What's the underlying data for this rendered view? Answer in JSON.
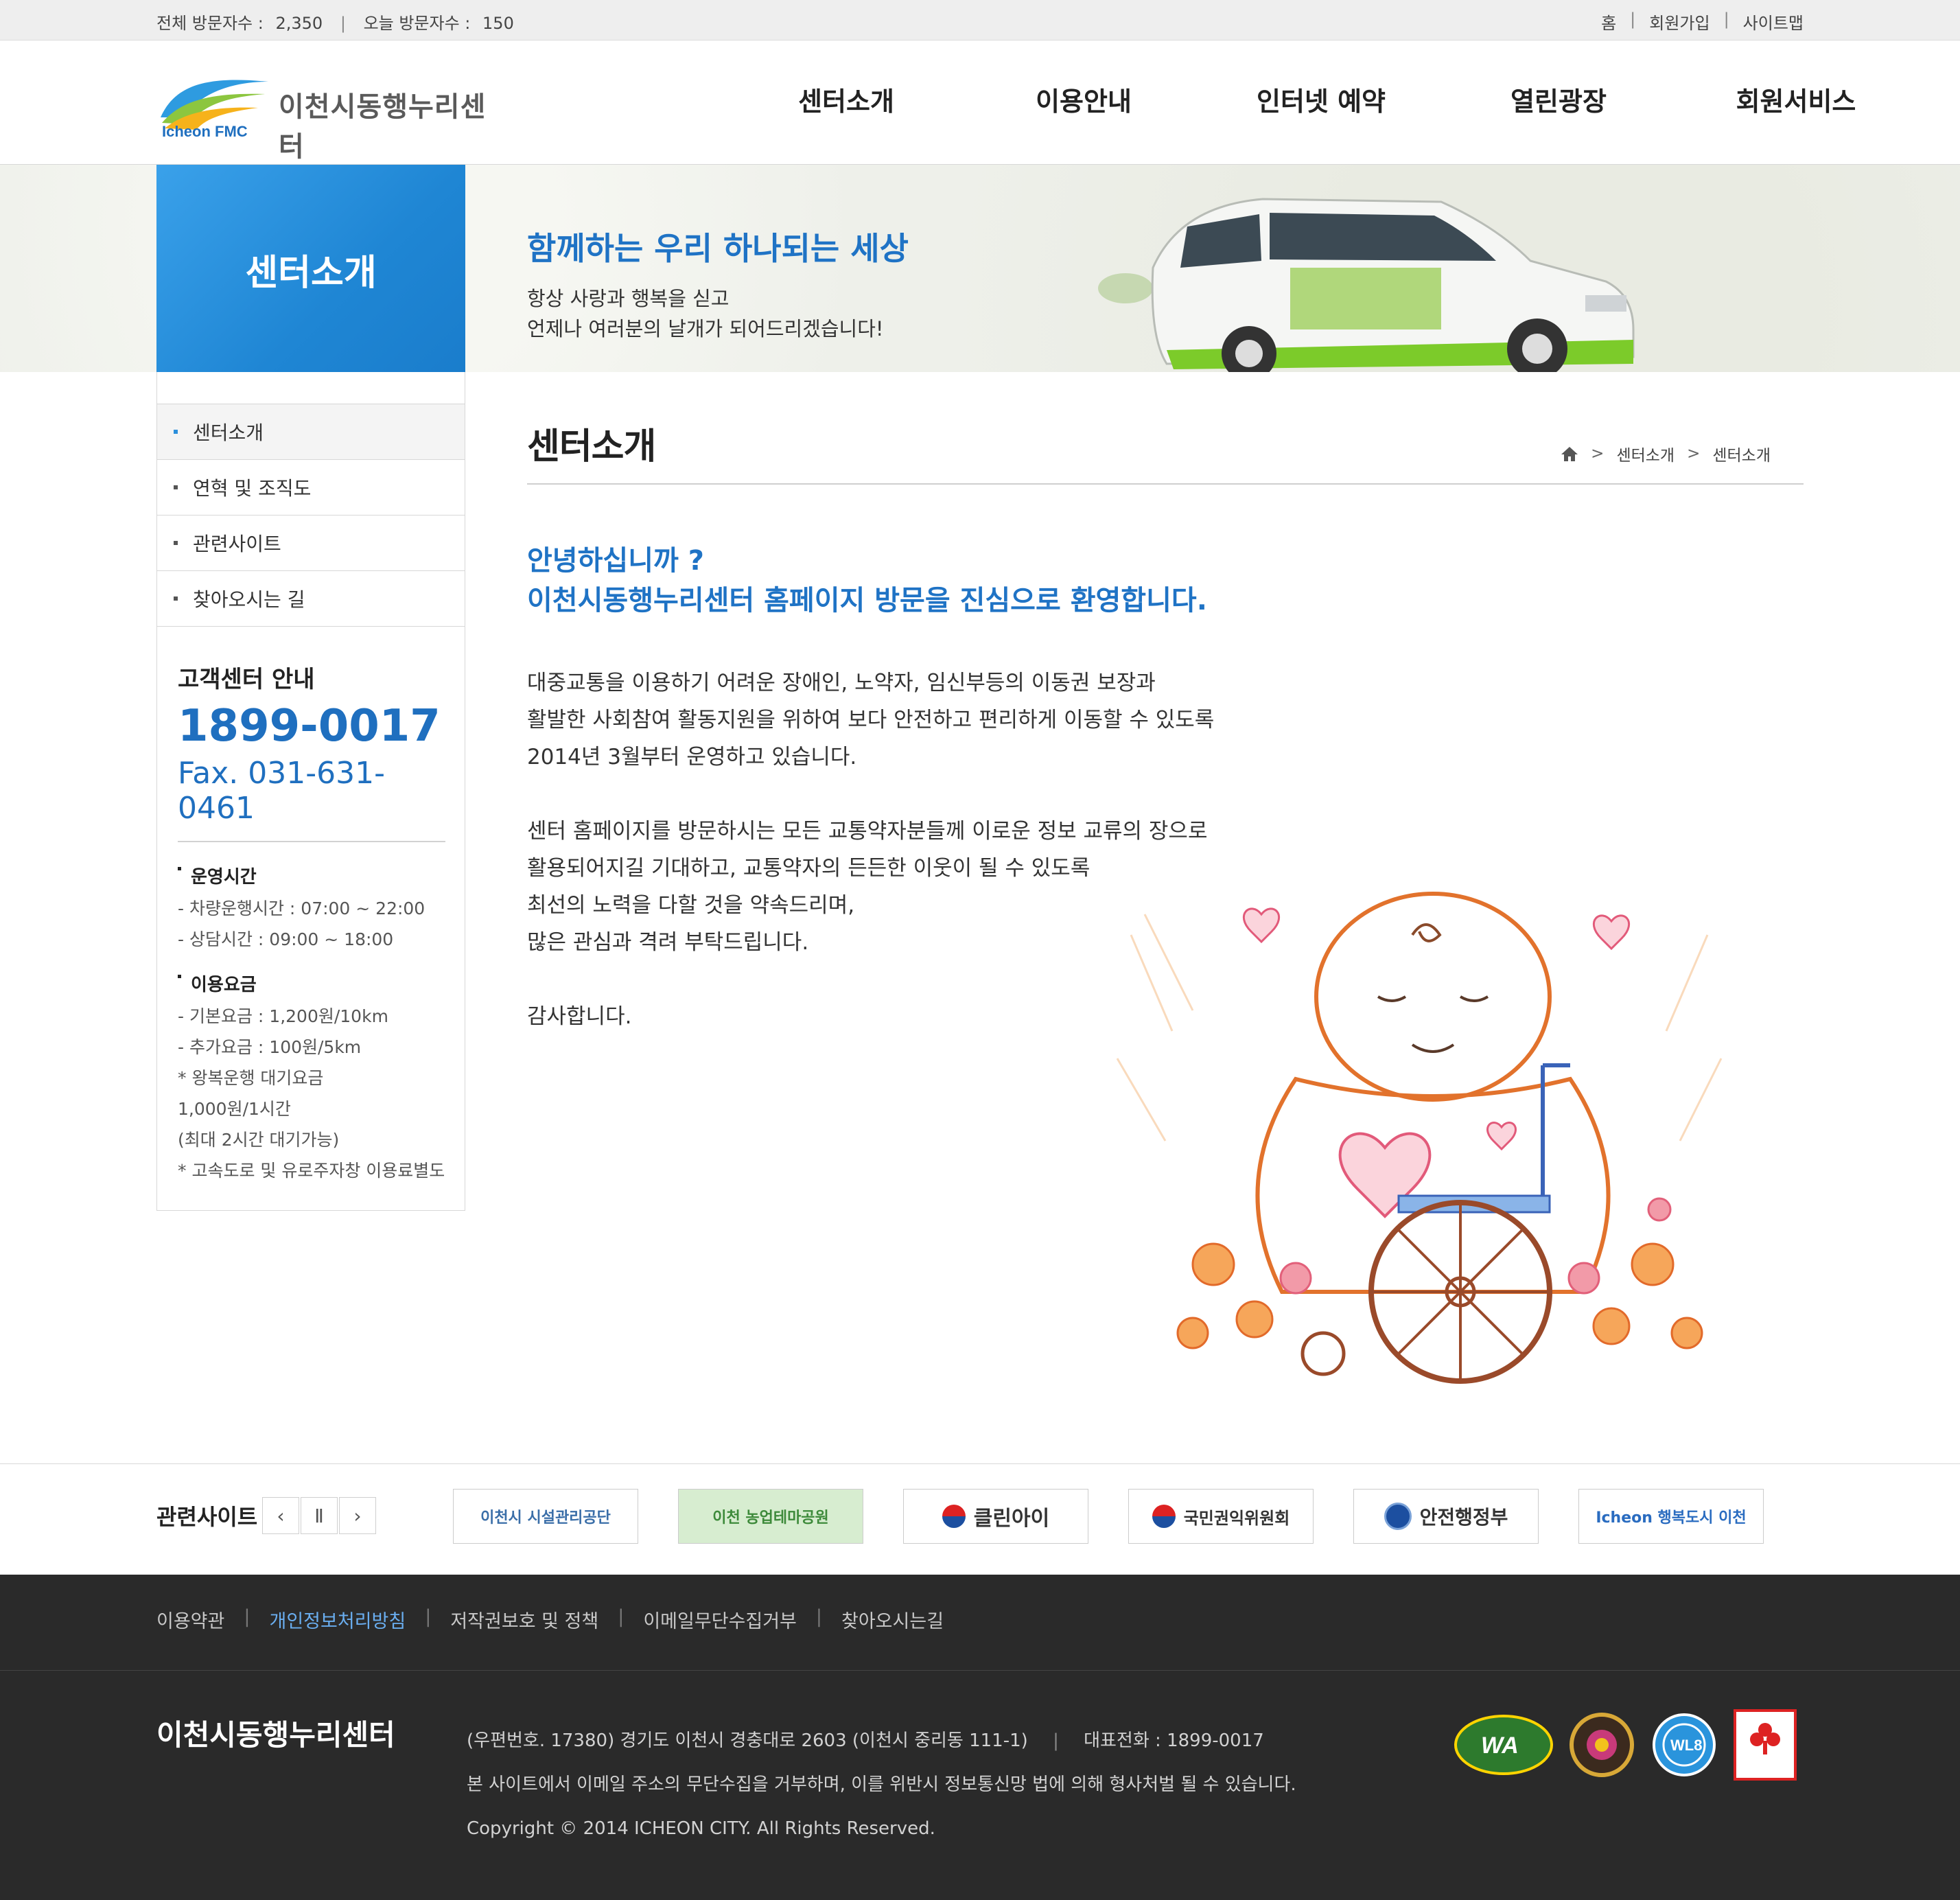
{
  "top": {
    "counter": {
      "total_label": "전체 방문자수 :",
      "total_value": "2,350",
      "today_label": "오늘 방문자수 :",
      "today_value": "150"
    },
    "util": [
      "홈",
      "회원가입",
      "사이트맵"
    ]
  },
  "header": {
    "logo_text": "이천시동행누리센터",
    "logo_sub": "Icheon FMC",
    "gnb": [
      "센터소개",
      "이용안내",
      "인터넷 예약",
      "열린광장",
      "회원서비스"
    ]
  },
  "visual": {
    "section_title": "센터소개",
    "slogan": "함께하는 우리 하나되는 세상",
    "sub1": "항상 사랑과 행복을 싣고",
    "sub2": "언제나 여러분의 날개가 되어드리겠습니다!"
  },
  "lnb": {
    "items": [
      {
        "label": "센터소개",
        "active": true
      },
      {
        "label": "연혁 및 조직도",
        "active": false
      },
      {
        "label": "관련사이트",
        "active": false
      },
      {
        "label": "찾아오시는 길",
        "active": false
      }
    ],
    "cs": {
      "title": "고객센터 안내",
      "phone": "1899-0017",
      "fax": "Fax. 031-631-0461",
      "hours_title": "운영시간",
      "hours": [
        "- 차량운행시간 : 07:00 ~ 22:00",
        "- 상담시간 : 09:00 ~ 18:00"
      ],
      "fee_title": "이용요금",
      "fees": [
        "- 기본요금 : 1,200원/10km",
        "- 추가요금 : 100원/5km",
        "* 왕복운행 대기요금",
        "1,000원/1시간",
        "(최대 2시간 대기가능)",
        "* 고속도로 및 유로주자창 이용료별도"
      ]
    }
  },
  "content": {
    "page_title": "센터소개",
    "breadcrumb": [
      "센터소개",
      "센터소개"
    ],
    "greet1": "안녕하십니까 ?",
    "greet2": "이천시동행누리센터 홈페이지 방문을 진심으로 환영합니다.",
    "para1": [
      "대중교통을 이용하기 어려운 장애인, 노약자, 임신부등의 이동권 보장과",
      "활발한 사회참여 활동지원을 위하여 보다 안전하고 편리하게 이동할 수 있도록",
      "2014년 3월부터 운영하고 있습니다."
    ],
    "para2": [
      "센터 홈페이지를 방문하시는 모든 교통약자분들께 이로운 정보 교류의 장으로",
      "활용되어지길 기대하고, 교통약자의 든든한 이웃이 될 수 있도록",
      "최선의 노력을 다할 것을 약속드리며,",
      "많은 관심과 격려 부탁드립니다."
    ],
    "closing": "감사합니다."
  },
  "related": {
    "title": "관련사이트",
    "banners": [
      "이천시 시설관리공단",
      "이천 농업테마공원",
      "클린아이",
      "국민권익위원회",
      "안전행정부",
      "Icheon 행복도시 이천"
    ]
  },
  "footer": {
    "links": [
      "이용약관",
      "개인정보처리방침",
      "저작권보호 및 정책",
      "이메일무단수집거부",
      "찾아오시는길"
    ],
    "name": "이천시동행누리센터",
    "address": "(우편번호. 17380) 경기도 이천시 경충대로 2603 (이천시 중리동 111-1)",
    "tel": "대표전화 : 1899-0017",
    "notice": "본 사이트에서 이메일 주소의 무단수집을 거부하며, 이를 위반시 정보통신망 법에 의해 형사처벌 될 수 있습니다.",
    "copyright": "Copyright © 2014 ICHEON CITY. All Rights Reserved.",
    "marks": [
      "WA",
      "WL8"
    ]
  },
  "colors": {
    "accent": "#1f73c5",
    "section_box": "#2b8fdc",
    "footer_bg": "#2a2a2a"
  }
}
